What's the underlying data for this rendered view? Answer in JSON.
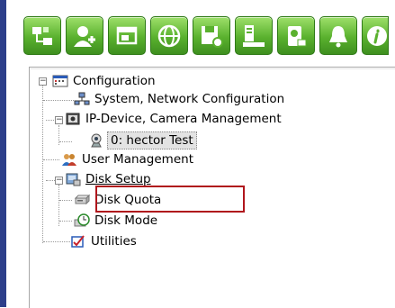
{
  "toolbar": {
    "buttons": [
      {
        "name": "network-config-icon"
      },
      {
        "name": "add-user-icon"
      },
      {
        "name": "window-icon"
      },
      {
        "name": "globe-icon"
      },
      {
        "name": "save-settings-icon"
      },
      {
        "name": "keyboard-monitor-icon"
      },
      {
        "name": "device-icon"
      },
      {
        "name": "bell-icon"
      },
      {
        "name": "info-icon"
      }
    ]
  },
  "tree": {
    "root": {
      "label": "Configuration",
      "expanded": true
    },
    "items": [
      {
        "label": "System, Network Configuration"
      },
      {
        "label": "IP-Device, Camera Management",
        "expanded": true
      },
      {
        "label": "0: hector Test"
      },
      {
        "label": "User Management"
      },
      {
        "label": "Disk Setup",
        "expanded": true
      },
      {
        "label": "Disk Quota",
        "highlighted": true
      },
      {
        "label": "Disk Mode"
      },
      {
        "label": "Utilities"
      }
    ]
  },
  "colors": {
    "toolbar_green": "#5ab12e",
    "highlight_border": "#b0161c",
    "left_border": "#2d3f8a"
  }
}
